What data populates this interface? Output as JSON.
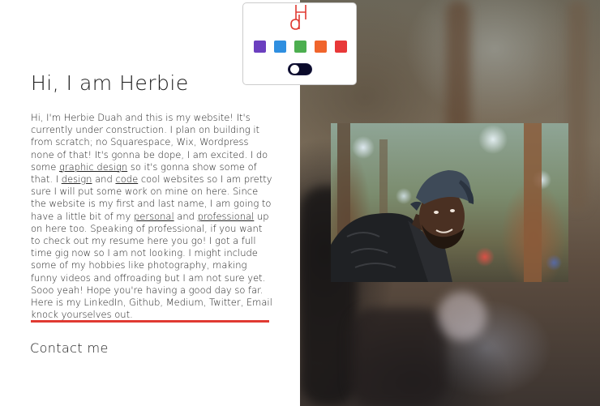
{
  "logo": {
    "alt_text": "HD logo",
    "color": "#e03a32"
  },
  "palette": {
    "swatches": [
      {
        "name": "purple",
        "color": "#6b3fbf"
      },
      {
        "name": "blue",
        "color": "#2f8fe0"
      },
      {
        "name": "green",
        "color": "#4cae4f"
      },
      {
        "name": "orange",
        "color": "#f0642c"
      },
      {
        "name": "red",
        "color": "#e83838"
      }
    ],
    "dark_mode_on": false
  },
  "intro": {
    "heading": "Hi, I am Herbie"
  },
  "bio": {
    "t1": "Hi, I'm Herbie Duah and this is my website! It's currently under construction. I plan on building it from scratch; no Squarespace, Wix, Wordpress none of that! It's gonna be dope, I am excited. I do some ",
    "link_graphic_design": "graphic design",
    "t2": " so it's gonna show some of that. I ",
    "link_design": "design",
    "t3": " and ",
    "link_code": "code",
    "t4": " cool websites so I am pretty sure I will put some work on mine on here. Since the website is my first and last name, I am going to have a little bit of my ",
    "link_personal": "personal",
    "t5": " and ",
    "link_professional": "professional",
    "t6": " up on here too. Speaking of professional, if you want to check out my resume here you go! I got a full time gig now so I am not looking. I might include some of my hobbies like photography, making funny videos and offroading but I am not sure yet. Sooo yeah! Hope you're having a good day so far. Here is my LinkedIn, Github, Medium, Twitter, Email knock yourselves out."
  },
  "divider_color": "#e03a32",
  "contact": {
    "label": "Contact me"
  },
  "photo": {
    "alt": "Herbie in the forest"
  }
}
